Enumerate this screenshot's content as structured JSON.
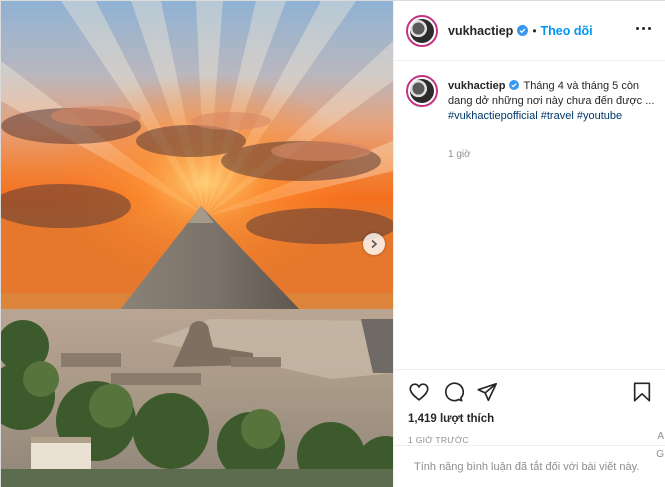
{
  "post": {
    "username": "vukhactiep",
    "follow_label": "Theo dõi",
    "separator": "•",
    "caption_text": "Tháng 4 và tháng 5 còn dang dở những nơi này chưa đến được ... ",
    "hashtags": [
      "#vukhactiepofficial",
      "#travel",
      "#youtube"
    ],
    "caption_age": "1 giờ",
    "likes": "1,419 lượt thích",
    "posted_time": "1 GIỜ TRƯỚC",
    "comments_disabled": "Tính năng bình luận đã tắt đối với bài viết này."
  },
  "sidebar_fragments": {
    "a": "A",
    "g": "G"
  },
  "icons": {
    "verified": "verified-badge-icon",
    "more": "more-options-icon",
    "like": "heart-icon",
    "comment": "comment-icon",
    "share": "share-icon",
    "save": "bookmark-icon",
    "next": "chevron-right-icon"
  },
  "colors": {
    "accent": "#0095f6",
    "verified": "#3897f0",
    "text": "#262626",
    "muted": "#8e8e8e",
    "hashtag": "#00376b"
  }
}
